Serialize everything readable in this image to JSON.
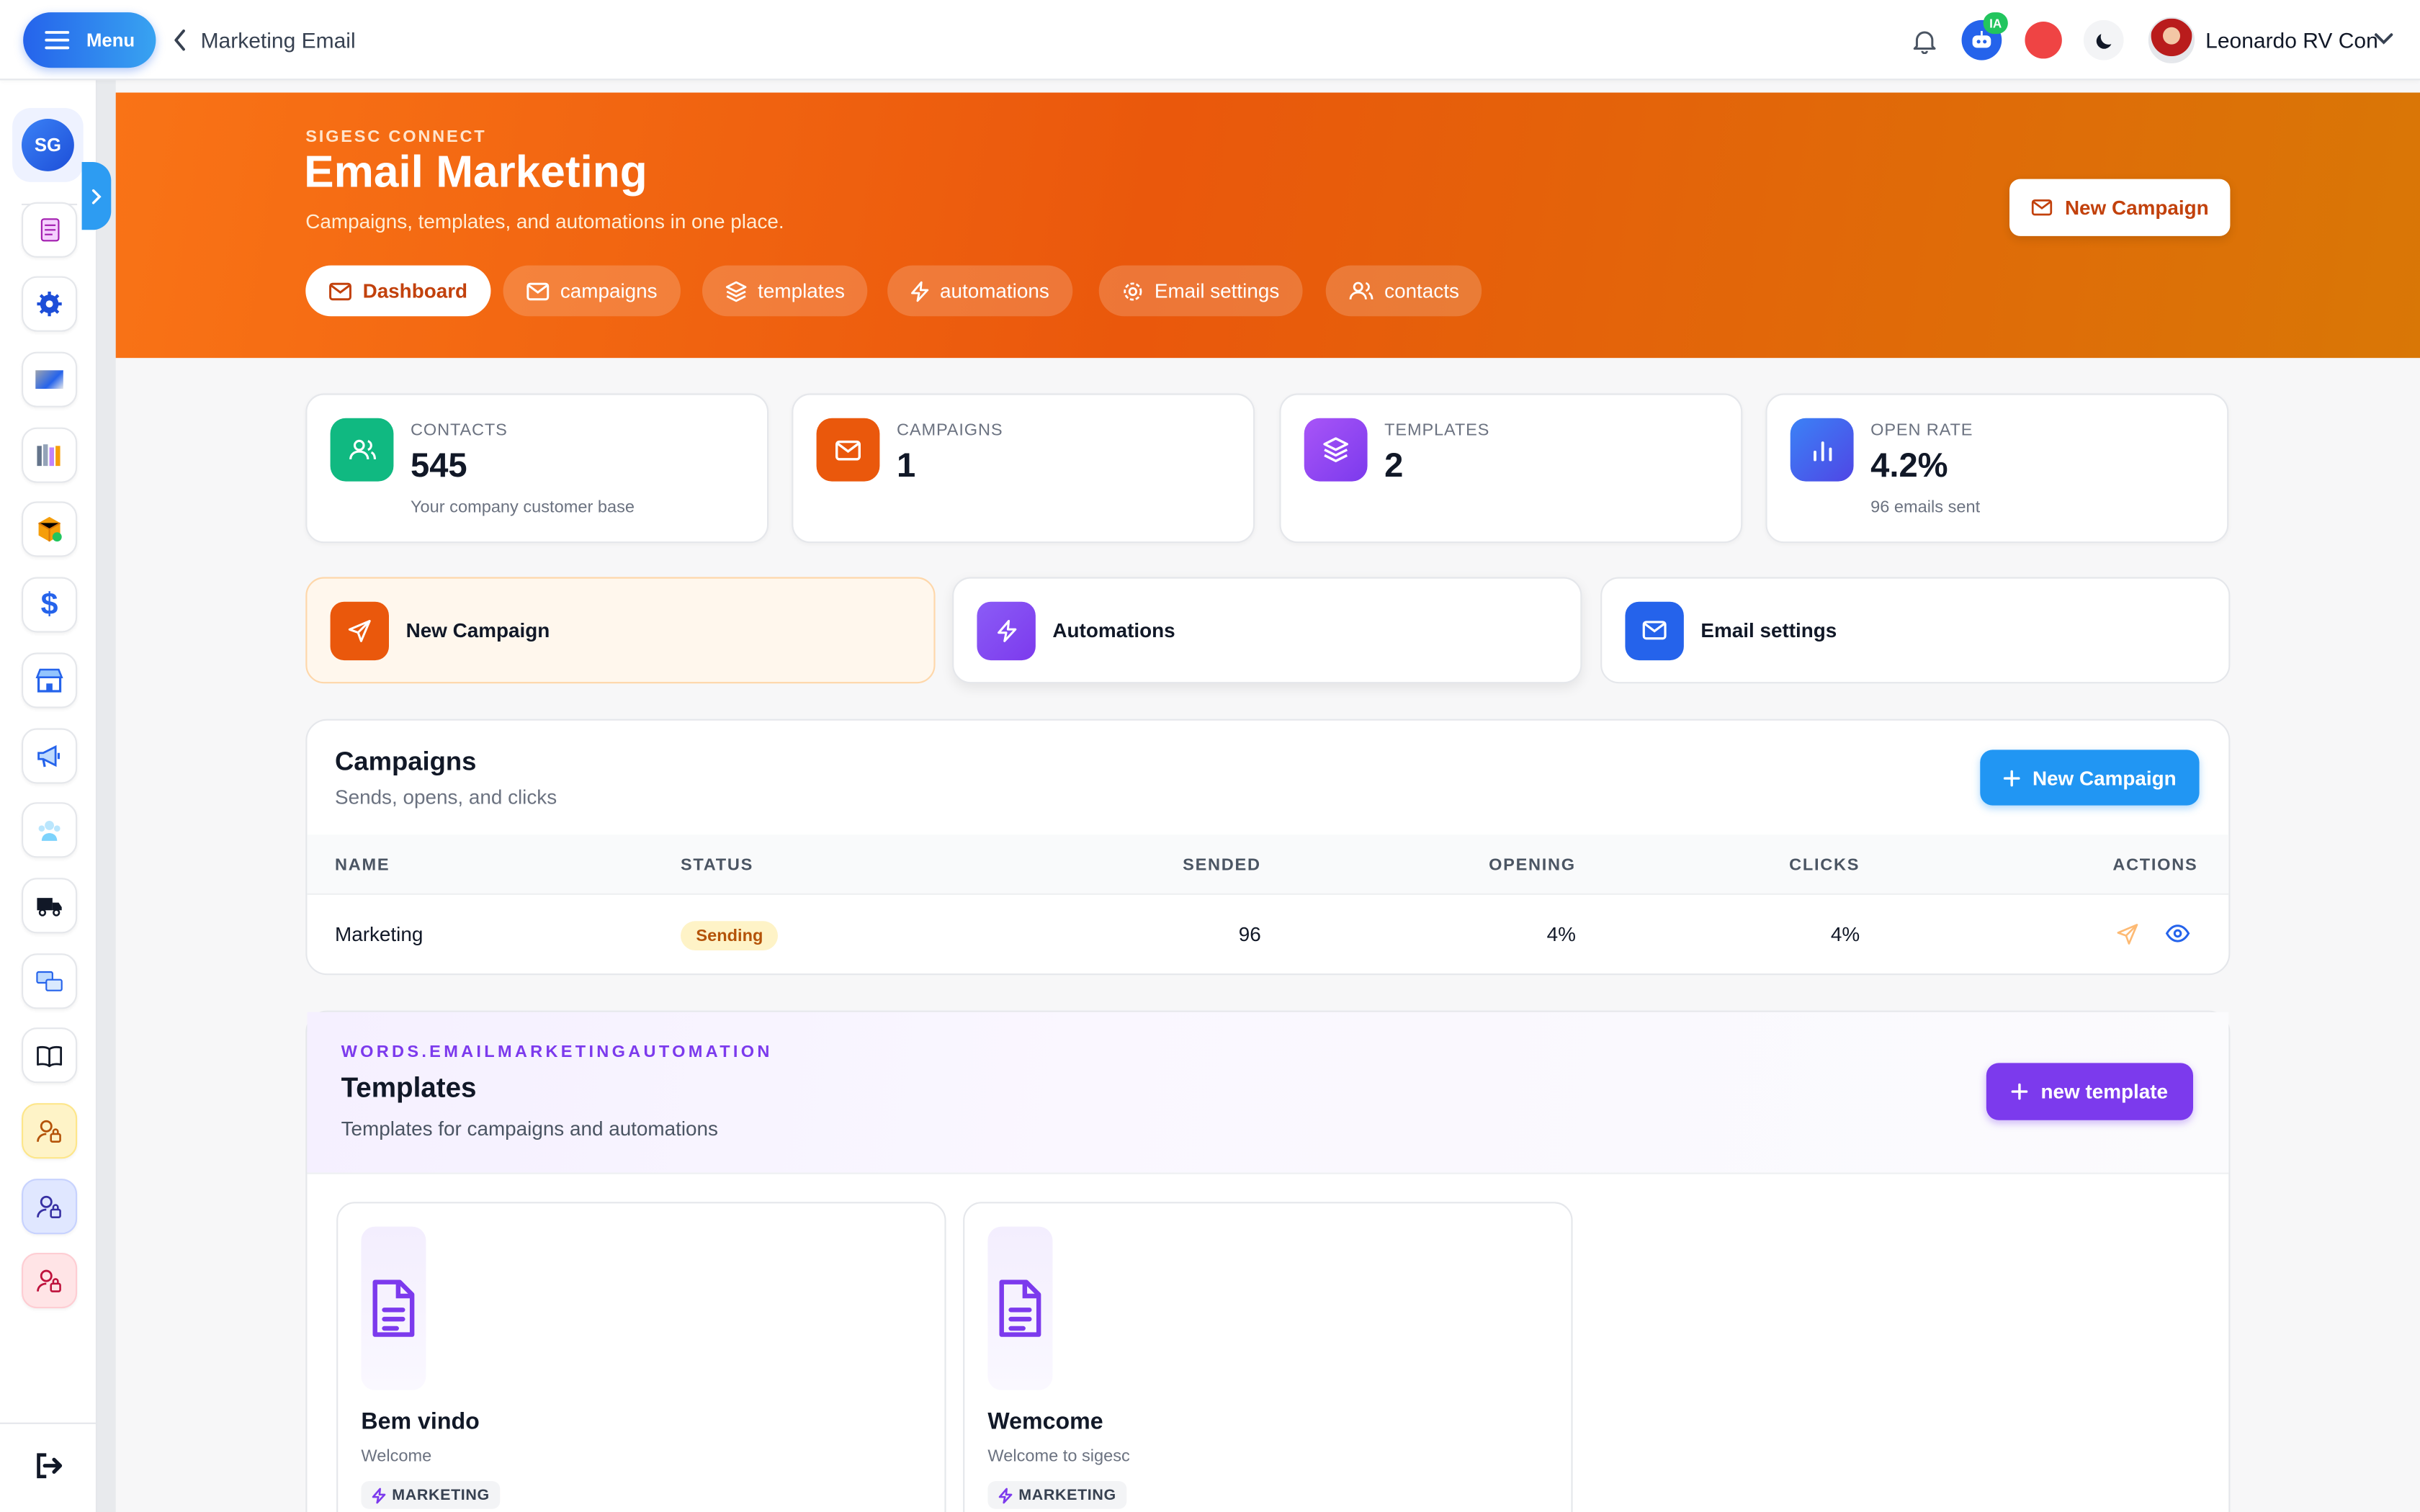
{
  "topbar": {
    "menu_label": "Menu",
    "breadcrumb": "Marketing Email",
    "ia_badge": "IA",
    "user_name": "Leonardo RV Con"
  },
  "sidebar": {
    "logo": "SG",
    "items": [
      "document-icon",
      "settings-icon",
      "gradient-icon",
      "books-icon",
      "package-icon",
      "dollar-icon",
      "store-icon",
      "megaphone-icon",
      "team-icon",
      "truck-icon",
      "exchange-icon",
      "book-icon",
      "user-lock-icon",
      "user-lock-icon",
      "user-lock-icon"
    ]
  },
  "hero": {
    "subtitle": "SIGESC CONNECT",
    "title": "Email Marketing",
    "description": "Campaigns, templates, and automations in one place.",
    "tabs": [
      "Dashboard",
      "campaigns",
      "templates",
      "automations",
      "Email settings",
      "contacts"
    ],
    "new_campaign": "New Campaign"
  },
  "stats": [
    {
      "label": "CONTACTS",
      "value": "545",
      "sub": "Your company customer base",
      "color": "#10b981"
    },
    {
      "label": "CAMPAIGNS",
      "value": "1",
      "sub": "",
      "color": "#ea580c"
    },
    {
      "label": "TEMPLATES",
      "value": "2",
      "sub": "",
      "color": "#8b5cf6"
    },
    {
      "label": "OPEN RATE",
      "value": "4.2%",
      "sub": "96 emails sent",
      "color": "#2563eb"
    }
  ],
  "actions": [
    "New Campaign",
    "Automations",
    "Email settings"
  ],
  "campaigns": {
    "title": "Campaigns",
    "subtitle": "Sends, opens, and clicks",
    "new_button": "New Campaign",
    "columns": [
      "NAME",
      "STATUS",
      "SENDED",
      "OPENING",
      "CLICKS",
      "ACTIONS"
    ],
    "rows": [
      {
        "name": "Marketing",
        "status": "Sending",
        "sended": "96",
        "opening": "4%",
        "clicks": "4%"
      }
    ]
  },
  "templates": {
    "eyebrow": "WORDS.EMAILMARKETINGAUTOMATION",
    "title": "Templates",
    "subtitle": "Templates for campaigns and automations",
    "new_button": "new template",
    "items": [
      {
        "name": "Bem vindo",
        "desc": "Welcome",
        "tag": "MARKETING"
      },
      {
        "name": "Wemcome",
        "desc": "Welcome to sigesc",
        "tag": "MARKETING"
      }
    ]
  },
  "colors": {
    "brand_orange": "#ea580c",
    "brand_blue": "#2196f3",
    "brand_purple": "#7c3aed"
  }
}
